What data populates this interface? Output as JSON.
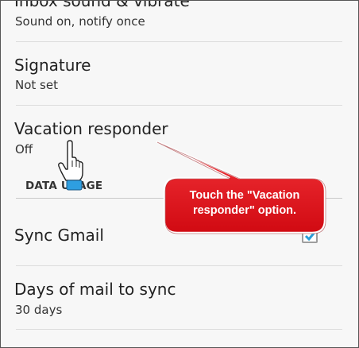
{
  "settings": {
    "inbox_sound": {
      "title": "Inbox sound & vibrate",
      "summary": "Sound on, notify once"
    },
    "signature": {
      "title": "Signature",
      "summary": "Not set"
    },
    "vacation_responder": {
      "title": "Vacation responder",
      "summary": "Off"
    },
    "data_usage_header": "DATA USAGE",
    "sync_gmail": {
      "title": "Sync Gmail",
      "checked": true
    },
    "days_to_sync": {
      "title": "Days of mail to sync",
      "summary": "30 days"
    }
  },
  "callout": {
    "line1": "Touch the \"Vacation",
    "line2": "responder\" option.",
    "color": "#e8141c"
  },
  "icons": {
    "pointer": "hand-pointer-icon",
    "checkmark": "checkmark-icon"
  }
}
